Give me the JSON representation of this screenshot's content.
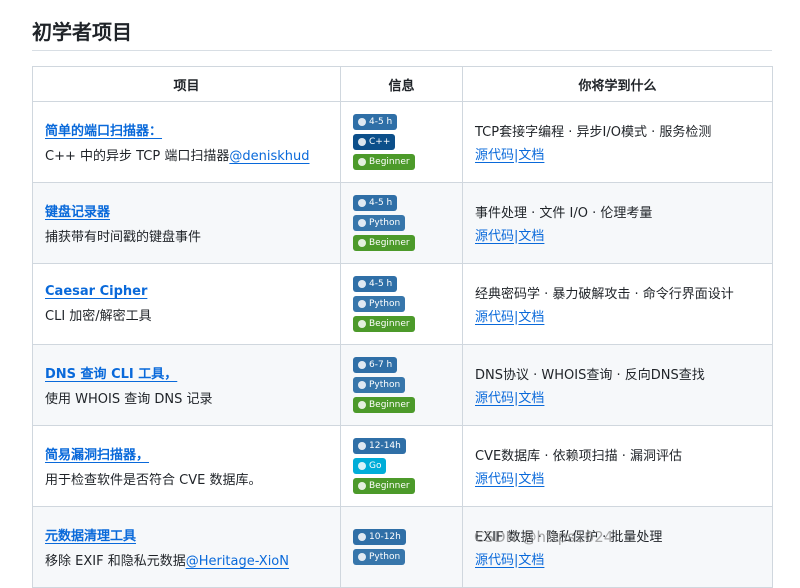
{
  "page": {
    "title": "初学者项目"
  },
  "table": {
    "headers": [
      "项目",
      "信息",
      "你将学到什么"
    ],
    "rows": [
      {
        "name": "简单的端口扫描器：",
        "desc": "C++ 中的异步 TCP 端口扫描器",
        "author": "@deniskhud",
        "badges": [
          {
            "text": "4-5 h",
            "icon": "clock-icon",
            "color": "#2f6fa7"
          },
          {
            "text": "C++",
            "icon": "cpp-icon",
            "color": "#0c4f8a"
          },
          {
            "text": "Beginner",
            "icon": "dot-icon",
            "color": "#4c9a2a"
          }
        ],
        "learn": "TCP套接字编程 · 异步I/O模式 · 服务检测",
        "source_label": "源代码",
        "docs_label": "文档"
      },
      {
        "name": "键盘记录器",
        "desc": "捕获带有时间戳的键盘事件",
        "author": "",
        "badges": [
          {
            "text": "4-5 h",
            "icon": "clock-icon",
            "color": "#2f6fa7"
          },
          {
            "text": "Python",
            "icon": "python-icon",
            "color": "#3776ab"
          },
          {
            "text": "Beginner",
            "icon": "dot-icon",
            "color": "#4c9a2a"
          }
        ],
        "learn": "事件处理 · 文件 I/O · 伦理考量",
        "source_label": "源代码",
        "docs_label": "文档"
      },
      {
        "name": "Caesar Cipher",
        "desc": "CLI 加密/解密工具",
        "author": "",
        "badges": [
          {
            "text": "4-5 h",
            "icon": "clock-icon",
            "color": "#2f6fa7"
          },
          {
            "text": "Python",
            "icon": "python-icon",
            "color": "#3776ab"
          },
          {
            "text": "Beginner",
            "icon": "dot-icon",
            "color": "#4c9a2a"
          }
        ],
        "learn": "经典密码学 · 暴力破解攻击 · 命令行界面设计",
        "source_label": "源代码",
        "docs_label": "文档"
      },
      {
        "name": "DNS 查询 CLI 工具，",
        "desc": "使用 WHOIS 查询 DNS 记录",
        "author": "",
        "badges": [
          {
            "text": "6-7 h",
            "icon": "clock-icon",
            "color": "#2f6fa7"
          },
          {
            "text": "Python",
            "icon": "python-icon",
            "color": "#3776ab"
          },
          {
            "text": "Beginner",
            "icon": "dot-icon",
            "color": "#4c9a2a"
          }
        ],
        "learn": "DNS协议 · WHOIS查询 · 反向DNS查找",
        "source_label": "源代码",
        "docs_label": "文档"
      },
      {
        "name": "简易漏洞扫描器，",
        "desc": "用于检查软件是否符合 CVE 数据库。",
        "author": "",
        "badges": [
          {
            "text": "12-14h",
            "icon": "clock-icon",
            "color": "#2f6fa7"
          },
          {
            "text": "Go",
            "icon": "go-icon",
            "color": "#00add8"
          },
          {
            "text": "Beginner",
            "icon": "dot-icon",
            "color": "#4c9a2a"
          }
        ],
        "learn": "CVE数据库 · 依赖项扫描 · 漏洞评估",
        "source_label": "源代码",
        "docs_label": "文档"
      },
      {
        "name": "元数据清理工具",
        "desc": "移除 EXIF 和隐私元数据",
        "author": "@Heritage-XioN",
        "badges": [
          {
            "text": "10-12h",
            "icon": "clock-icon",
            "color": "#2f6fa7"
          },
          {
            "text": "Python",
            "icon": "python-icon",
            "color": "#3776ab"
          }
        ],
        "learn": "EXIF 数据 · 隐私保护 · 批量处理",
        "source_label": "源代码",
        "docs_label": "文档"
      }
    ]
  },
  "watermark": "CSDN @https1024"
}
